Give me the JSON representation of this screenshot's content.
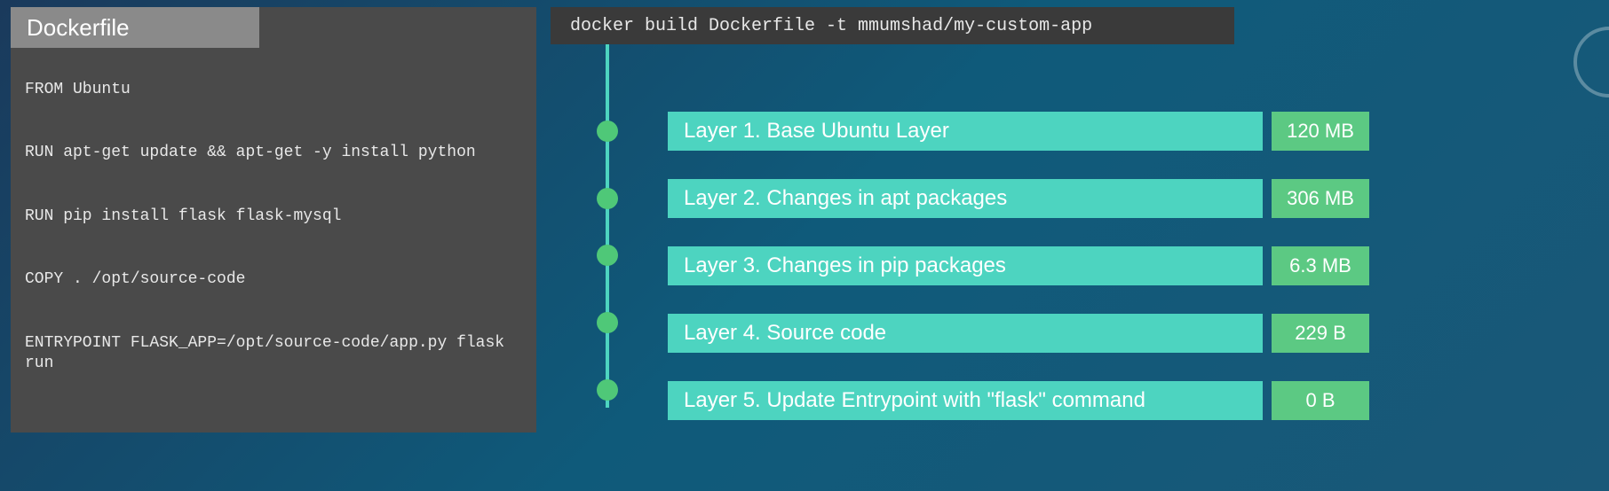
{
  "dockerfile": {
    "tab_label": "Dockerfile",
    "lines": [
      "FROM Ubuntu",
      "RUN apt-get update && apt-get -y install python",
      "RUN pip install flask flask-mysql",
      "COPY . /opt/source-code",
      "ENTRYPOINT FLASK_APP=/opt/source-code/app.py flask run"
    ]
  },
  "command": "docker build Dockerfile -t mmumshad/my-custom-app",
  "layers": [
    {
      "label": "Layer 1. Base Ubuntu Layer",
      "size": "120 MB"
    },
    {
      "label": "Layer 2. Changes in apt packages",
      "size": "306 MB"
    },
    {
      "label": "Layer 3. Changes in pip packages",
      "size": "6.3 MB"
    },
    {
      "label": "Layer 4. Source code",
      "size": "229 B"
    },
    {
      "label": "Layer 5. Update Entrypoint with \"flask\" command",
      "size": "0 B"
    }
  ]
}
